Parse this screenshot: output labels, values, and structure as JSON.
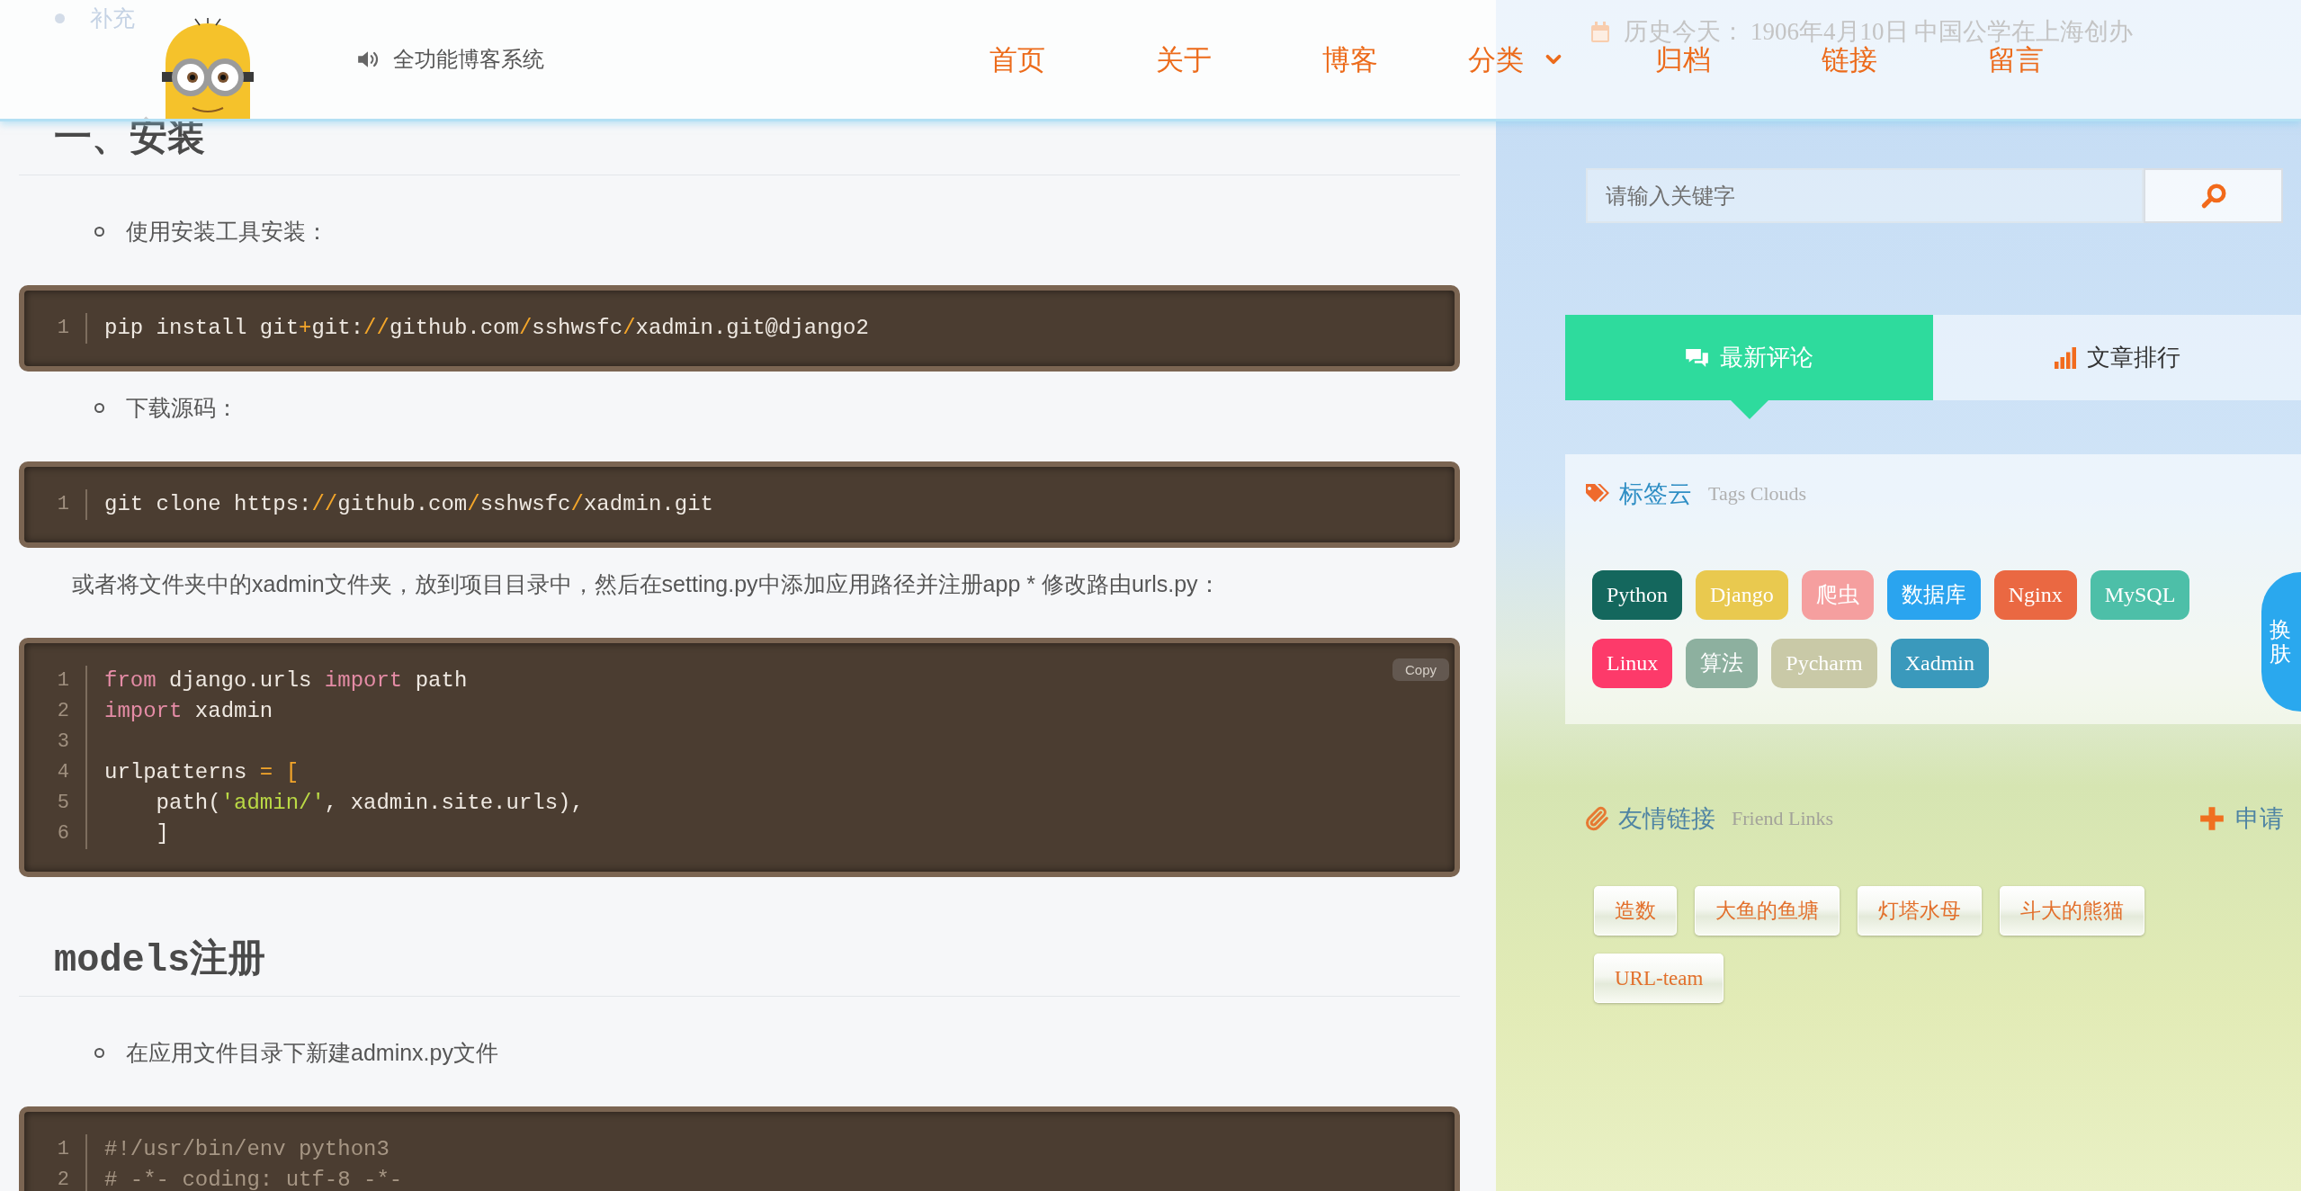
{
  "header": {
    "site_title": "全功能博客系统",
    "nav": [
      {
        "label": "首页",
        "kind": "link"
      },
      {
        "label": "关于",
        "kind": "link"
      },
      {
        "label": "博客",
        "kind": "link"
      },
      {
        "label": "分类",
        "kind": "dropdown"
      },
      {
        "label": "归档",
        "kind": "link"
      },
      {
        "label": "链接",
        "kind": "link"
      },
      {
        "label": "留言",
        "kind": "link"
      }
    ]
  },
  "article": {
    "blocks": [
      {
        "kind": "list_item",
        "nested": false,
        "link": true,
        "text": "补充"
      },
      {
        "kind": "heading",
        "text": "一、安装"
      },
      {
        "kind": "list_item",
        "nested": true,
        "link": false,
        "text": "使用安装工具安装："
      },
      {
        "kind": "code",
        "lines": [
          {
            "number": "1",
            "tokens": [
              {
                "kind": "plain",
                "text": "pip install git"
              },
              {
                "kind": "operator",
                "text": "+"
              },
              {
                "kind": "plain",
                "text": "git:"
              },
              {
                "kind": "operator",
                "text": "//"
              },
              {
                "kind": "plain",
                "text": "github.com"
              },
              {
                "kind": "operator",
                "text": "/"
              },
              {
                "kind": "plain",
                "text": "sshwsfc"
              },
              {
                "kind": "operator",
                "text": "/"
              },
              {
                "kind": "plain",
                "text": "xadmin.git@django2"
              }
            ]
          }
        ]
      },
      {
        "kind": "list_item",
        "nested": true,
        "link": false,
        "text": "下载源码："
      },
      {
        "kind": "code",
        "lines": [
          {
            "number": "1",
            "tokens": [
              {
                "kind": "plain",
                "text": "git clone https:"
              },
              {
                "kind": "operator",
                "text": "//"
              },
              {
                "kind": "plain",
                "text": "github.com"
              },
              {
                "kind": "operator",
                "text": "/"
              },
              {
                "kind": "plain",
                "text": "sshwsfc"
              },
              {
                "kind": "operator",
                "text": "/"
              },
              {
                "kind": "plain",
                "text": "xadmin.git"
              }
            ]
          }
        ]
      },
      {
        "kind": "paragraph",
        "text": "或者将文件夹中的xadmin文件夹，放到项目目录中，然后在setting.py中添加应用路径并注册app * 修改路由urls.py："
      },
      {
        "kind": "code",
        "copy_button": "Copy",
        "lines": [
          {
            "number": "1",
            "tokens": [
              {
                "kind": "keyword",
                "text": "from"
              },
              {
                "kind": "plain",
                "text": " django.urls "
              },
              {
                "kind": "keyword",
                "text": "import"
              },
              {
                "kind": "plain",
                "text": " path"
              }
            ]
          },
          {
            "number": "2",
            "tokens": [
              {
                "kind": "keyword",
                "text": "import"
              },
              {
                "kind": "plain",
                "text": " xadmin"
              }
            ]
          },
          {
            "number": "3"
          },
          {
            "number": "4",
            "tokens": [
              {
                "kind": "plain",
                "text": "urlpatterns "
              },
              {
                "kind": "operator",
                "text": "="
              },
              {
                "kind": "operator",
                "text": " ["
              }
            ]
          },
          {
            "number": "5",
            "tokens": [
              {
                "kind": "plain",
                "text": "    path("
              },
              {
                "kind": "string",
                "text": "'admin/'"
              },
              {
                "kind": "plain",
                "text": ", xadmin.site.urls),"
              }
            ]
          },
          {
            "number": "6",
            "tokens": [
              {
                "kind": "plain",
                "text": "    ]"
              }
            ]
          }
        ]
      },
      {
        "kind": "heading",
        "text": "models注册"
      },
      {
        "kind": "list_item",
        "nested": true,
        "link": false,
        "text": "在应用文件目录下新建adminx.py文件"
      },
      {
        "kind": "code",
        "lines": [
          {
            "number": "1",
            "tokens": [
              {
                "kind": "comment",
                "text": "#!/usr/bin/env python3"
              }
            ]
          },
          {
            "number": "2",
            "tokens": [
              {
                "kind": "comment",
                "text": "# -*- coding: utf-8 -*-"
              }
            ]
          }
        ]
      }
    ]
  },
  "sidebar": {
    "history": {
      "label": "历史今天：",
      "text": "1906年4月10日 中国公学在上海创办"
    },
    "search": {
      "placeholder": "请输入关键字"
    },
    "tabs": [
      {
        "label": "最新评论",
        "selected": true
      },
      {
        "label": "文章排行",
        "selected": false
      }
    ],
    "tag_cloud": {
      "title": "标签云",
      "subtitle": "Tags Clouds",
      "tags": [
        {
          "label": "Python",
          "color": "#14675d"
        },
        {
          "label": "Django",
          "color": "#e9c94f"
        },
        {
          "label": "爬虫",
          "color": "#f59f9f"
        },
        {
          "label": "数据库",
          "color": "#2aa4ef"
        },
        {
          "label": "Nginx",
          "color": "#ea6842"
        },
        {
          "label": "MySQL",
          "color": "#4dbfa8"
        },
        {
          "label": "Linux",
          "color": "#fd3a6a"
        },
        {
          "label": "算法",
          "color": "#8db09f"
        },
        {
          "label": "Pycharm",
          "color": "#c9c9a7"
        },
        {
          "label": "Xadmin",
          "color": "#3a99bc"
        }
      ]
    },
    "friend_links": {
      "title": "友情链接",
      "subtitle": "Friend Links",
      "apply": "申请",
      "links": [
        "造数",
        "大鱼的鱼塘",
        "灯塔水母",
        "斗大的熊猫",
        "URL-team"
      ]
    }
  },
  "skin_button": {
    "label": "换肤"
  }
}
